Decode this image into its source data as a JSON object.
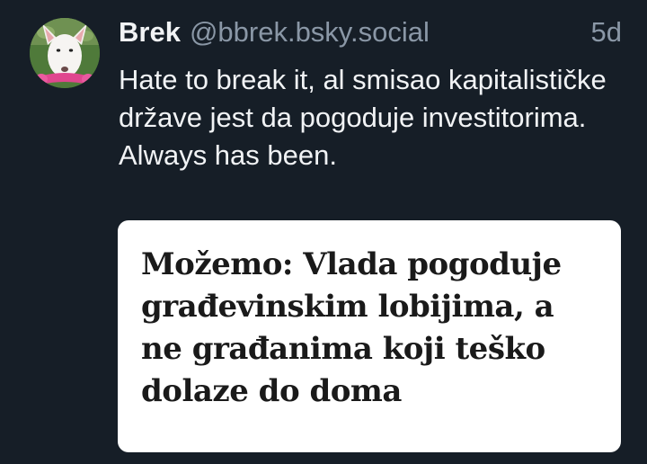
{
  "post": {
    "author": {
      "display_name": "Brek",
      "handle": "@bbrek.bsky.social",
      "avatar_icon": "bull-terrier-avatar"
    },
    "timestamp": "5d",
    "text": "Hate to break it, al smisao kapitalističke države jest da pogoduje investitorima. Always has been.",
    "embed": {
      "title": "Možemo: Vlada pogoduje građevinskim lobijima, a ne građanima koji teško dolaze do doma"
    }
  },
  "colors": {
    "background": "#161e27",
    "text_primary": "#f1f3f5",
    "text_secondary": "#8a97a6",
    "card_background": "#ffffff",
    "card_text": "#1a1a1a"
  }
}
